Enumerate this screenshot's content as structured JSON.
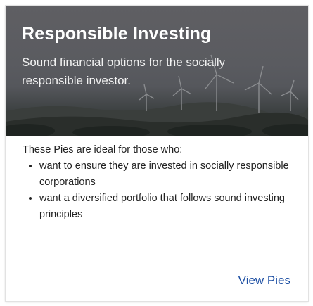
{
  "card": {
    "title": "Responsible Investing",
    "subtitle": "Sound financial options for the socially responsible investor.",
    "intro": "These Pies are ideal for those who:",
    "bullets": [
      "want to ensure they are invested in socially responsible corporations",
      "want a diversified portfolio that follows sound investing principles"
    ],
    "link_label": "View Pies"
  },
  "colors": {
    "link": "#1d4fa3",
    "hero_overlay": "#5a5b60",
    "text": "#222222"
  },
  "hero_image": {
    "subject": "wind-turbines-landscape"
  }
}
